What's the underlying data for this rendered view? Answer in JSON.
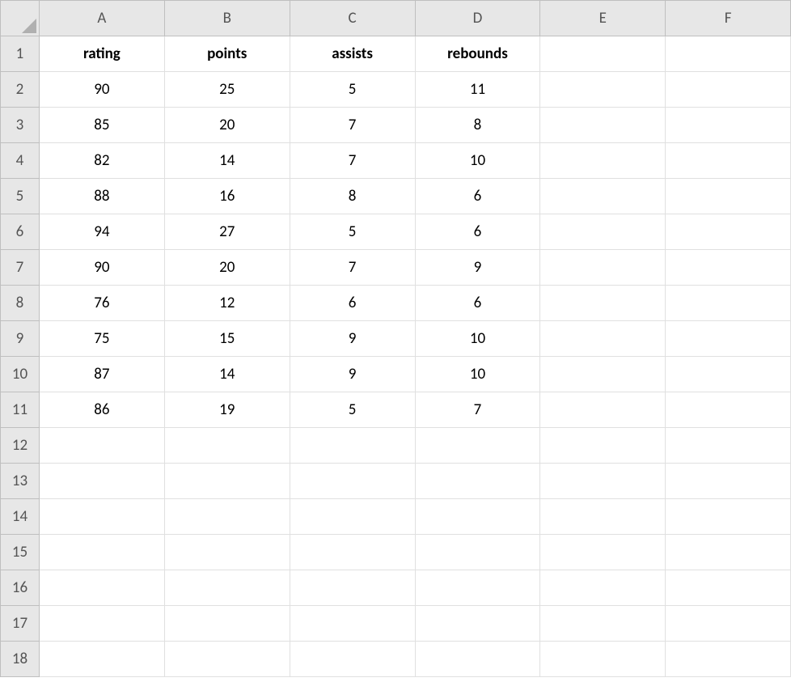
{
  "columns": [
    "A",
    "B",
    "C",
    "D",
    "E",
    "F"
  ],
  "rowCount": 18,
  "headers": {
    "A": "rating",
    "B": "points",
    "C": "assists",
    "D": "rebounds"
  },
  "data": [
    {
      "A": "90",
      "B": "25",
      "C": "5",
      "D": "11"
    },
    {
      "A": "85",
      "B": "20",
      "C": "7",
      "D": "8"
    },
    {
      "A": "82",
      "B": "14",
      "C": "7",
      "D": "10"
    },
    {
      "A": "88",
      "B": "16",
      "C": "8",
      "D": "6"
    },
    {
      "A": "94",
      "B": "27",
      "C": "5",
      "D": "6"
    },
    {
      "A": "90",
      "B": "20",
      "C": "7",
      "D": "9"
    },
    {
      "A": "76",
      "B": "12",
      "C": "6",
      "D": "6"
    },
    {
      "A": "75",
      "B": "15",
      "C": "9",
      "D": "10"
    },
    {
      "A": "87",
      "B": "14",
      "C": "9",
      "D": "10"
    },
    {
      "A": "86",
      "B": "19",
      "C": "5",
      "D": "7"
    }
  ]
}
